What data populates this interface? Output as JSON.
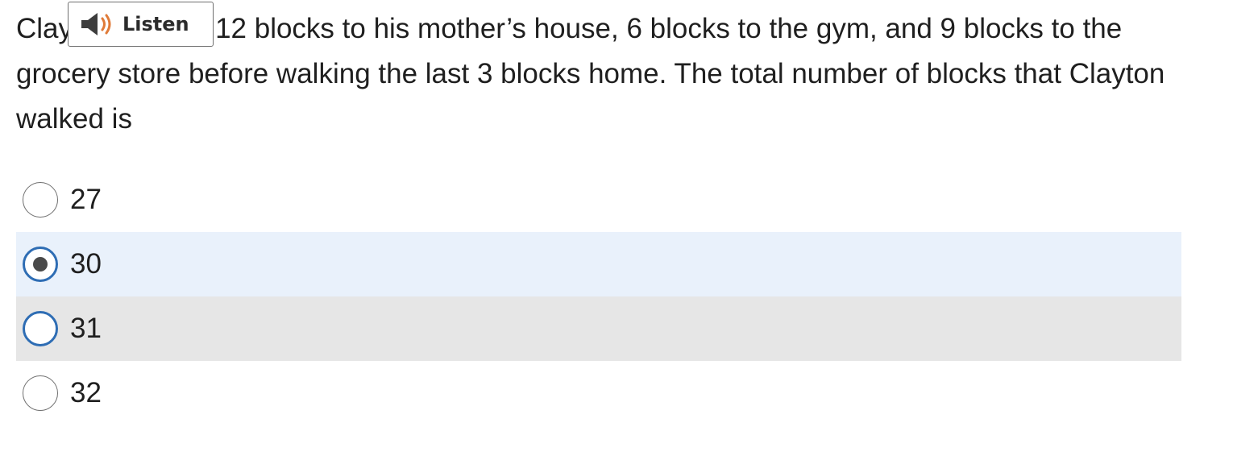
{
  "question": {
    "text": "Clayton walked 12 blocks to his mother’s house, 6 blocks to the gym, and 9 blocks to the grocery store before walking the last 3 blocks home. The total number of blocks that Clayton walked is"
  },
  "listen_button": {
    "label": "Listen",
    "icon": "speaker-icon"
  },
  "options": [
    {
      "label": "27",
      "selected": false
    },
    {
      "label": "30",
      "selected": true
    },
    {
      "label": "31",
      "selected": false
    },
    {
      "label": "32",
      "selected": false
    }
  ],
  "colors": {
    "selected_row": "#e9f1fb",
    "hover_row": "#e6e6e6",
    "radio_accent": "#2e6db4",
    "speaker_wave": "#e07b39"
  }
}
